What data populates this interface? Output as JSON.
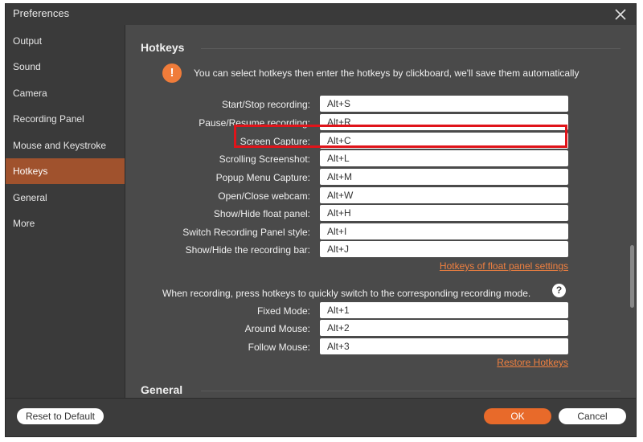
{
  "window": {
    "title": "Preferences"
  },
  "sidebar": {
    "items": [
      {
        "label": "Output",
        "active": false
      },
      {
        "label": "Sound",
        "active": false
      },
      {
        "label": "Camera",
        "active": false
      },
      {
        "label": "Recording Panel",
        "active": false
      },
      {
        "label": "Mouse and Keystroke",
        "active": false
      },
      {
        "label": "Hotkeys",
        "active": true
      },
      {
        "label": "General",
        "active": false
      },
      {
        "label": "More",
        "active": false
      }
    ]
  },
  "hotkeys": {
    "title": "Hotkeys",
    "info": "You can select hotkeys then enter the hotkeys by clickboard, we'll save them automatically",
    "rows": [
      {
        "label": "Start/Stop recording:",
        "value": "Alt+S"
      },
      {
        "label": "Pause/Resume recording:",
        "value": "Alt+R"
      },
      {
        "label": "Screen Capture:",
        "value": "Alt+C"
      },
      {
        "label": "Scrolling Screenshot:",
        "value": "Alt+L"
      },
      {
        "label": "Popup Menu Capture:",
        "value": "Alt+M"
      },
      {
        "label": "Open/Close webcam:",
        "value": "Alt+W"
      },
      {
        "label": "Show/Hide float panel:",
        "value": "Alt+H"
      },
      {
        "label": "Switch Recording Panel style:",
        "value": "Alt+I"
      },
      {
        "label": "Show/Hide the recording bar:",
        "value": "Alt+J"
      }
    ],
    "float_link": "Hotkeys of float panel settings",
    "recording_text": "When recording, press hotkeys to quickly switch to the corresponding recording mode.",
    "mode_rows": [
      {
        "label": "Fixed Mode:",
        "value": "Alt+1"
      },
      {
        "label": "Around Mouse:",
        "value": "Alt+2"
      },
      {
        "label": "Follow Mouse:",
        "value": "Alt+3"
      }
    ],
    "restore_link": "Restore Hotkeys"
  },
  "general": {
    "title": "General"
  },
  "footer": {
    "reset_label": "Reset to Default",
    "ok_label": "OK",
    "cancel_label": "Cancel"
  },
  "icons": {
    "info": "exclamation-icon",
    "help": "question-icon",
    "close": "close-icon"
  },
  "colors": {
    "accent": "#e86a2a",
    "active_nav": "#a0522d",
    "highlight": "#e0141a",
    "link": "#f08040"
  }
}
